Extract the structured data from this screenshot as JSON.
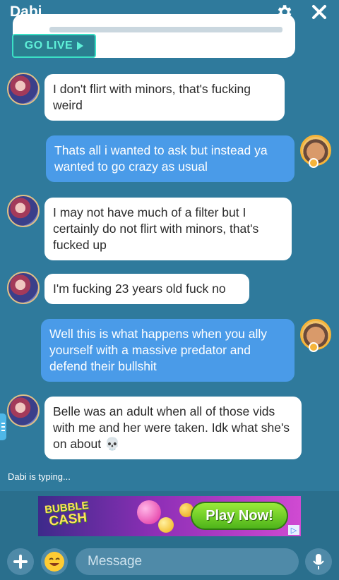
{
  "header": {
    "title": "Dabi",
    "settings_icon": "gear-icon",
    "close_icon": "close-icon"
  },
  "go_live_label": "GO LIVE",
  "messages": [
    {
      "sender": "Dabi",
      "direction": "in",
      "text": "I don't flirt with minors, that's fucking weird"
    },
    {
      "sender": "me",
      "direction": "out",
      "text": "Thats all i wanted to ask but instead ya wanted to go crazy as usual"
    },
    {
      "sender": "Dabi",
      "direction": "in",
      "text": "I may not have much of a filter but I certainly do not flirt with minors, that's fucked up"
    },
    {
      "sender": "Dabi",
      "direction": "in",
      "text": "I'm fucking 23 years old fuck no"
    },
    {
      "sender": "me",
      "direction": "out",
      "text": "Well this is what happens when you ally yourself with a massive predator and defend their bullshit"
    },
    {
      "sender": "Dabi",
      "direction": "in",
      "text": "Belle was an adult when all of those vids with me and her were taken. Idk what she's on about 💀"
    }
  ],
  "typing_indicator": "Dabi is typing...",
  "ad": {
    "logo_line1": "BUBBLE",
    "logo_line2": "CASH",
    "cta": "Play Now!",
    "info_glyph": "▷"
  },
  "input": {
    "placeholder": "Message",
    "value": ""
  },
  "colors": {
    "background": "#2f7a9c",
    "incoming_bubble": "#ffffff",
    "outgoing_bubble": "#4a9be8",
    "go_live": "#3be0c5"
  }
}
